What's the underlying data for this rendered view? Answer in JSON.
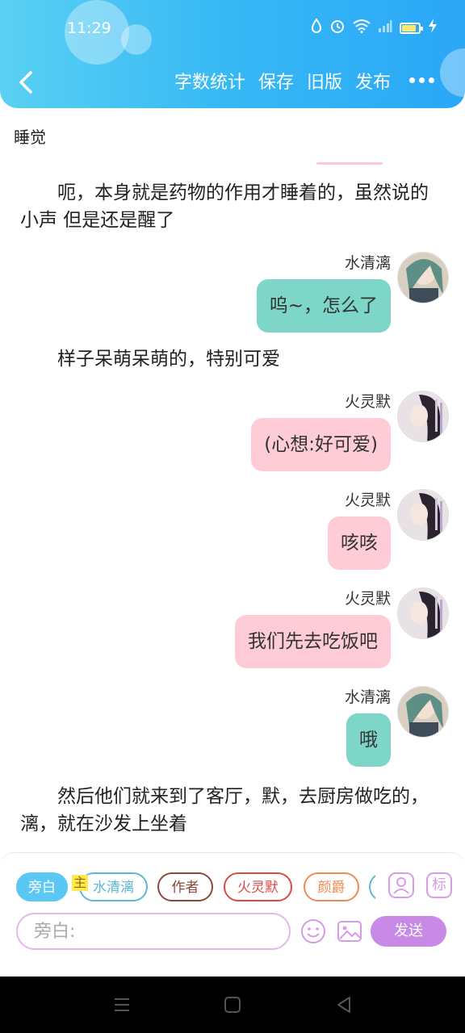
{
  "status_bar": {
    "time": "11:29"
  },
  "header": {
    "actions": [
      "字数统计",
      "保存",
      "旧版",
      "发布"
    ]
  },
  "story_title": "睡觉",
  "messages": [
    {
      "type": "narration",
      "text": "呃，本身就是药物的作用才睡着的，虽然说的小声 但是还是醒了"
    },
    {
      "type": "chat",
      "sender": "水清漓",
      "text": "呜~，怎么了",
      "bubble_color": "#7ed6c8",
      "avatar": "shuiqingli-avatar"
    },
    {
      "type": "narration",
      "text": "样子呆萌呆萌的，特别可爱"
    },
    {
      "type": "chat",
      "sender": "火灵默",
      "text": "(心想:好可爱)",
      "bubble_color": "#fdccd6",
      "avatar": "huolingmo-avatar"
    },
    {
      "type": "chat",
      "sender": "火灵默",
      "text": "咳咳",
      "bubble_color": "#fdccd6",
      "avatar": "huolingmo-avatar"
    },
    {
      "type": "chat",
      "sender": "火灵默",
      "text": "我们先去吃饭吧",
      "bubble_color": "#fdccd6",
      "avatar": "huolingmo-avatar"
    },
    {
      "type": "chat",
      "sender": "水清漓",
      "text": "哦",
      "bubble_color": "#7ed6c8",
      "avatar": "shuiqingli-avatar"
    },
    {
      "type": "narration",
      "text": "然后他们就来到了客厅，默，去厨房做吃的，漓，就在沙发上坐着"
    }
  ],
  "input_panel": {
    "roles": [
      {
        "label": "旁白",
        "active": true
      },
      {
        "label": "水清漓",
        "active": false,
        "color": "#5ab8d6"
      },
      {
        "label": "作者",
        "active": false,
        "color": "#8a4a3a"
      },
      {
        "label": "火灵默",
        "active": false,
        "color": "#d94b4b"
      },
      {
        "label": "颜爵",
        "active": false,
        "color": "#f08a55"
      }
    ],
    "main_tag": "主",
    "placeholder": "旁白:",
    "send_label": "发送",
    "mark_label": "标"
  },
  "colors": {
    "header_gradient_start": "#5ad0f3",
    "header_gradient_end": "#2ba7f6",
    "teal_bubble": "#7ed6c8",
    "pink_bubble": "#fdccd6",
    "send_button": "#c88ae6"
  }
}
